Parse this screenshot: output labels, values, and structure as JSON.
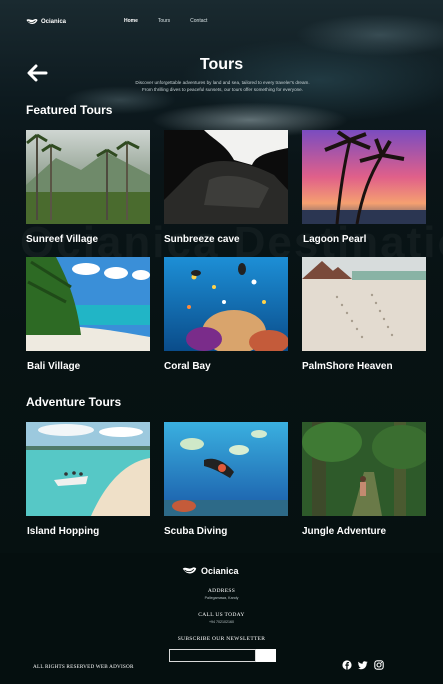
{
  "brand": {
    "name": "Ocianica"
  },
  "nav": {
    "items": [
      {
        "label": "Home",
        "active": true
      },
      {
        "label": "Tours",
        "active": false
      },
      {
        "label": "Contact",
        "active": false
      }
    ]
  },
  "hero": {
    "title": "Tours",
    "subtitle_line1": "Discover unforgettable adventures by land and sea, tailored to every traveler's dream.",
    "subtitle_line2": "From thrilling dives to peaceful sunsets, our tours offer something for everyone."
  },
  "featured": {
    "title": "Featured Tours",
    "tours": [
      "Sunreef Village",
      "Sunbreeze cave",
      "Lagoon Pearl",
      "Bali Village",
      "Coral Bay",
      "PalmShore Heaven"
    ]
  },
  "adventure": {
    "title": "Adventure Tours",
    "tours": [
      "Island Hopping",
      "Scuba Diving",
      "Jungle Adventure"
    ]
  },
  "footer": {
    "brand": "Ocianica",
    "address_label": "ADDRESS",
    "address_value": "Pallegamawa, Kandy",
    "call_label": "CALL US TODAY",
    "call_value": "+94 702102160",
    "newsletter_label": "SUBSCRIBE OUR NEWSLETTER",
    "rights": "ALL RIGHTS RESERVED WEB ADVISOR",
    "socials": [
      "facebook-icon",
      "twitter-icon",
      "instagram-icon"
    ]
  },
  "colors": {
    "background": "#061414",
    "footer": "#050f0f",
    "text": "#ffffff"
  }
}
